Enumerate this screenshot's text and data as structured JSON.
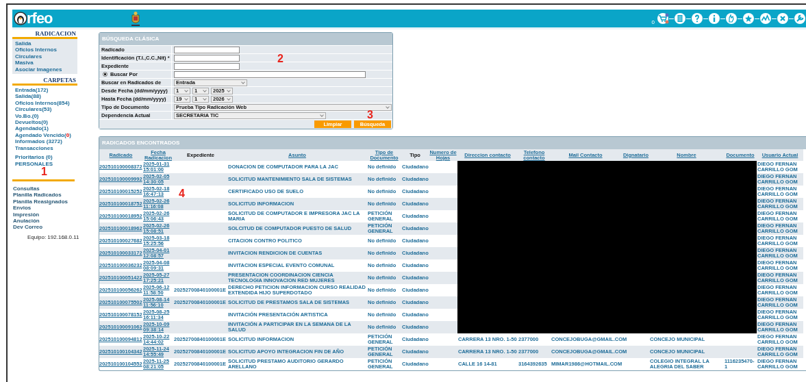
{
  "header": {
    "logo": "rfeo",
    "cart_count": "0",
    "toolbar_icons": [
      {
        "kind": "cart"
      },
      {
        "kind": "list"
      },
      {
        "kind": "help"
      },
      {
        "kind": "info"
      },
      {
        "kind": "hand"
      },
      {
        "kind": "star"
      },
      {
        "kind": "chart"
      },
      {
        "kind": "close"
      },
      {
        "kind": "wrench"
      }
    ]
  },
  "sidebar": {
    "radicacion": {
      "title": "RADICACION",
      "items": [
        "Salida",
        "Oficios Internos",
        "Circulares",
        "Masiva",
        "Asociar Imagenes"
      ]
    },
    "carpetas": {
      "title": "CARPETAS",
      "items": [
        {
          "label": "Entrada(172)"
        },
        {
          "label": "Salida(88)"
        },
        {
          "label": "Oficios Internos(854)"
        },
        {
          "label": "Circulares(53)"
        },
        {
          "label": "Vo.Bo.(0)"
        },
        {
          "label": "Devueltos(0)"
        },
        {
          "label": "Agendado(1)"
        },
        {
          "label": "Agendado Vencido(",
          "alert": "0",
          "suffix": ")"
        },
        {
          "label": "Informados (3272)"
        },
        {
          "label": "Transacciones"
        }
      ],
      "extra_items": [
        "Prioritarios (0)",
        "PERSONALES"
      ]
    },
    "menu": [
      "Consultas",
      "Planilla Radicados",
      "Planilla Reasignados",
      "Envios",
      "Impresión",
      "Anulación",
      "Dev Correo"
    ],
    "equipo": "Equipo: 192.168.0.11"
  },
  "search": {
    "title": "BÚSQUEDA CLÁSICA",
    "fields": [
      {
        "kind": "text",
        "label": "Radicado"
      },
      {
        "kind": "text",
        "label": "Identificación (T.I.,C.C.,Nit) *"
      },
      {
        "kind": "text",
        "label": "Expediente"
      },
      {
        "kind": "radio",
        "label": "Buscar Por",
        "selected": true
      },
      {
        "kind": "select",
        "label": "Buscar en Radicados de",
        "value": "Entrada"
      },
      {
        "kind": "date",
        "label": "Desde Fecha (dd/mm/yyyy)",
        "parts": [
          "1",
          "1",
          "2025"
        ]
      },
      {
        "kind": "date",
        "label": "Hasta Fecha (dd/mm/yyyy)",
        "parts": [
          "19",
          "1",
          "2026"
        ]
      },
      {
        "kind": "select-full",
        "label": "Tipo de Documento",
        "value": "Prueba Tipo Radicación Web"
      },
      {
        "kind": "select-long",
        "label": "Dependencia Actual",
        "value": "SECRETARIA TIC"
      }
    ],
    "buttons": [
      "Limpiar",
      "Búsqueda"
    ]
  },
  "results": {
    "title": "RADICADOS ENCONTRADOS",
    "columns": [
      {
        "label": "Radicado",
        "kind": "link"
      },
      {
        "label": "Fecha Radicacion",
        "kind": "link"
      },
      {
        "label": "Expediente",
        "kind": "plain"
      },
      {
        "label": "Asunto",
        "kind": "link"
      },
      {
        "label": "Tipo de Documento",
        "kind": "link"
      },
      {
        "label": "Tipo",
        "kind": "plain"
      },
      {
        "label": "Numero de Hojas",
        "kind": "link"
      },
      {
        "label": "Direccion contacto",
        "kind": "link"
      },
      {
        "label": "Telefono contacto",
        "kind": "link"
      },
      {
        "label": "Mail Contacto",
        "kind": "link"
      },
      {
        "label": "Dignatario",
        "kind": "link"
      },
      {
        "label": "Nombre",
        "kind": "link"
      },
      {
        "label": "Documento",
        "kind": "link"
      },
      {
        "label": "Usuario Actual",
        "kind": "link"
      }
    ],
    "rows": [
      {
        "radicado": "202510100008372",
        "fecha": "2025-01-31 15:01:00",
        "asunto": "DONACION DE COMPUTADOR PARA LA JAC",
        "tipo_documento": "No definido",
        "tipo": "Ciudadano",
        "usuario": "DIEGO FERNAN CARRILLO GOM",
        "redacted": true
      },
      {
        "radicado": "202510100009992",
        "fecha": "2025-02-05 14:30:05",
        "asunto": "SOLICITUD MANTENIMIENTO SALA DE SISTEMAS",
        "tipo_documento": "No definido",
        "tipo": "Ciudadano",
        "usuario": "DIEGO FERNAN CARRILLO GOM",
        "redacted": true
      },
      {
        "radicado": "202510100015252",
        "fecha": "2025-02-18 16:47:13",
        "asunto": "CERTIFICADO USO DE SUELO",
        "tipo_documento": "No definido",
        "tipo": "Ciudadano",
        "usuario": "DIEGO FERNAN CARRILLO GOM",
        "redacted": true
      },
      {
        "radicado": "202510100018752",
        "fecha": "2025-02-26 11:16:08",
        "asunto": "SOLICITUD INFORMACION",
        "tipo_documento": "No definido",
        "tipo": "Ciudadano",
        "usuario": "DIEGO FERNAN CARRILLO GOM",
        "redacted": true
      },
      {
        "radicado": "202510100018952",
        "fecha": "2025-02-26 15:06:43",
        "asunto": "SOLICITUD DE COMPUTADOR E IMPRESORA JAC LA MARIA",
        "tipo_documento": "PETICIÓN GENERAL",
        "tipo": "Ciudadano",
        "usuario": "DIEGO FERNAN CARRILLO GOM",
        "redacted": true
      },
      {
        "radicado": "202510100018962",
        "fecha": "2025-02-26 15:08:51",
        "asunto": "SOLCITUD DE COMPUTADOR PUESTO DE SALUD",
        "tipo_documento": "PETICIÓN GENERAL",
        "tipo": "Ciudadano",
        "usuario": "DIEGO FERNAN CARRILLO GOM",
        "redacted": true
      },
      {
        "radicado": "202510100027682",
        "fecha": "2025-03-18 15:25:56",
        "asunto": "CITACION CONTRO POLITICO",
        "tipo_documento": "No definido",
        "tipo": "Ciudadano",
        "usuario": "DIEGO FERNAN CARRILLO GOM",
        "redacted": true
      },
      {
        "radicado": "202510100033172",
        "fecha": "2025-04-01 12:08:57",
        "asunto": "INVITACION RENDICION DE CUENTAS",
        "tipo_documento": "No definido",
        "tipo": "Ciudadano",
        "usuario": "DIEGO FERNAN CARRILLO GOM",
        "redacted": true
      },
      {
        "radicado": "202510100036232",
        "fecha": "2025-04-08 08:09:31",
        "asunto": "INVITACION ESPECIAL EVENTO COMUNAL",
        "tipo_documento": "No definido",
        "tipo": "Ciudadano",
        "usuario": "DIEGO FERNAN CARRILLO GOM",
        "redacted": true
      },
      {
        "radicado": "202510100051422",
        "fecha": "2025-05-27 17:25:21",
        "asunto": "PRESENTACION COORDINACION CIENCIA TECNOLOGIA INNOVACION RED MUJERES",
        "tipo_documento": "No definido",
        "tipo": "Ciudadano",
        "usuario": "DIEGO FERNAN CARRILLO GOM",
        "redacted": true
      },
      {
        "radicado": "202510100056262",
        "fecha": "2025-06-12 11:58:50",
        "expediente": "20252700840100001E",
        "asunto": "DERECHO PETICION INFORMACION CURSO REALIDAD EXTENDIDA HIJO SUPERDOTADO",
        "tipo_documento": "No definido",
        "tipo": "Ciudadano",
        "usuario": "DIEGO FERNAN CARRILLO GOM",
        "redacted": true
      },
      {
        "radicado": "202510100075502",
        "fecha": "2025-08-14 11:56:10",
        "expediente": "20252700840100001E",
        "asunto": "SOLICITUD DE PRESTAMOS SALA DE SISTEMAS",
        "tipo_documento": "No definido",
        "tipo": "Ciudadano",
        "usuario": "DIEGO FERNAN CARRILLO GOM",
        "redacted": true
      },
      {
        "radicado": "202510100078152",
        "fecha": "2025-08-25 16:11:34",
        "asunto": "INVITACIÓN PRESENTACIÓN ARTISTICA",
        "tipo_documento": "No definido",
        "tipo": "Ciudadano",
        "usuario": "DIEGO FERNAN CARRILLO GOM",
        "redacted": true
      },
      {
        "radicado": "202510100091062",
        "fecha": "2025-10-09 09:38:14",
        "asunto": "INVITACIÓN A PARTICIPAR EN LA SEMANA DE LA SALUD",
        "tipo_documento": "No definido",
        "tipo": "Ciudadano",
        "usuario": "DIEGO FERNAN CARRILLO GOM",
        "redacted": true
      },
      {
        "radicado": "202510100094812",
        "fecha": "2025-10-22 14:44:02",
        "expediente": "20252700840100001E",
        "asunto": "SOLICITUD INFORMACION",
        "tipo_documento": "PETICIÓN GENERAL",
        "tipo": "Ciudadano",
        "direccion": "CARRERA 13 NRO. 1-50",
        "telefono": "2377000",
        "mail": "CONCEJOBUGA@GMAIL.COM",
        "nombre": "CONCEJO MUNICIPAL",
        "usuario": "DIEGO FERNAN CARRILLO GOM"
      },
      {
        "radicado": "202510100104342",
        "fecha": "2025-11-24 14:55:49",
        "expediente": "20252700840100001E",
        "asunto": "SOLICITUD APOYO INTEGRACION FIN DE AÑO",
        "tipo_documento": "PETICIÓN GENERAL",
        "tipo": "Ciudadano",
        "direccion": "CARRERA 13 NRO. 1-50",
        "telefono": "2377000",
        "mail": "CONCEJOBUGA@GMAIL.COM",
        "nombre": "CONCEJO MUNICIPAL",
        "usuario": "DIEGO FERNAN CARRILLO GOM"
      },
      {
        "radicado": "202510100104552",
        "fecha": "2025-11-25 08:21:05",
        "expediente": "20252700840100001E",
        "asunto": "SOLICITUD PRESTAMO AUDITORIO GERARDO ARELLANO",
        "tipo_documento": "PETICIÓN GENERAL",
        "tipo": "Ciudadano",
        "direccion": "CALLE 16 14-81",
        "telefono": "3164392635",
        "mail": "MIMAR1986@HOTMAIL.COM",
        "nombre": "COLEGIO INTEGRAL LA ALEGRIA DEL SABER",
        "documento": "1116235470-1",
        "usuario": "DIEGO FERNAN CARRILLO GOM"
      }
    ]
  },
  "annotations": [
    {
      "kind": "sidebar",
      "text": "1"
    },
    {
      "kind": "search",
      "text": "2"
    },
    {
      "kind": "button",
      "text": "3"
    },
    {
      "kind": "table",
      "text": "4"
    }
  ]
}
